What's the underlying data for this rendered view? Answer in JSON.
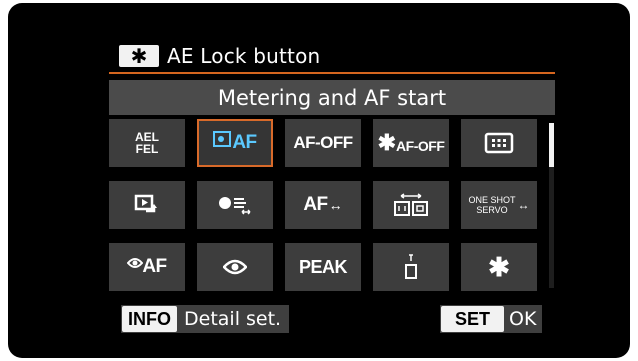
{
  "header": {
    "icon": "asterisk-icon",
    "icon_glyph": "✱",
    "title": "AE Lock button"
  },
  "selected_function": "Metering and AF start",
  "grid": [
    {
      "name": "ael-fel",
      "line1": "AEL",
      "line2": "FEL"
    },
    {
      "name": "metering-af-start",
      "label": "AF",
      "selected": true
    },
    {
      "name": "af-off",
      "label": "AF-OFF"
    },
    {
      "name": "ae-lock-af-off",
      "star": "✱",
      "label": "AF-OFF"
    },
    {
      "name": "af-point-selection",
      "icon": "af-point-frame-icon"
    },
    {
      "name": "playback",
      "icon": "playback-icon"
    },
    {
      "name": "metering-mode",
      "icon": "metering-mode-icon"
    },
    {
      "name": "af-switch",
      "label": "AF",
      "arrow": "↔"
    },
    {
      "name": "af-area-switch",
      "icon": "af-area-switch-icon"
    },
    {
      "name": "one-shot-servo",
      "line1": "ONE SHOT",
      "line2": "SERVO",
      "arrow": "↔"
    },
    {
      "name": "eye-af",
      "label": "AF",
      "icon": "eye-icon"
    },
    {
      "name": "eye-detection",
      "icon": "eye-icon"
    },
    {
      "name": "peaking",
      "label": "PEAK"
    },
    {
      "name": "electronic-level",
      "icon": "level-icon"
    },
    {
      "name": "ae-lock",
      "star": "✱"
    }
  ],
  "footer": {
    "info_key": "INFO",
    "info_label": "Detail set.",
    "set_key": "SET",
    "set_label": "OK"
  },
  "colors": {
    "selection_border": "#d86a2a",
    "selected_icon": "#5bc9ff",
    "separator": "#d5661f",
    "cell_bg": "#3d3d3d",
    "bar_bg": "#4b4b4b"
  }
}
